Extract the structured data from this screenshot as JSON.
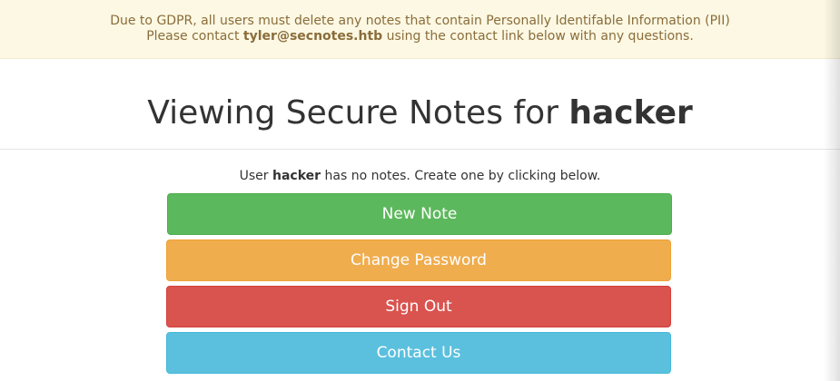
{
  "notice": {
    "line1": "Due to GDPR, all users must delete any notes that contain Personally Identifable Information (PII)",
    "line2_prefix": "Please contact ",
    "line2_email": "tyler@secnotes.htb",
    "line2_suffix": " using the contact link below with any questions."
  },
  "header": {
    "title_prefix": "Viewing Secure Notes for ",
    "username": "hacker"
  },
  "info": {
    "prefix": "User ",
    "username": "hacker",
    "suffix": " has no notes. Create one by clicking below."
  },
  "buttons": {
    "new_note": "New Note",
    "change_password": "Change Password",
    "sign_out": "Sign Out",
    "contact_us": "Contact Us"
  },
  "colors": {
    "notice_bg": "#fcf8e3",
    "notice_text": "#8a6d3b",
    "success": "#5cb85c",
    "warning": "#f0ad4e",
    "danger": "#d9534f",
    "info": "#5bc0de"
  }
}
